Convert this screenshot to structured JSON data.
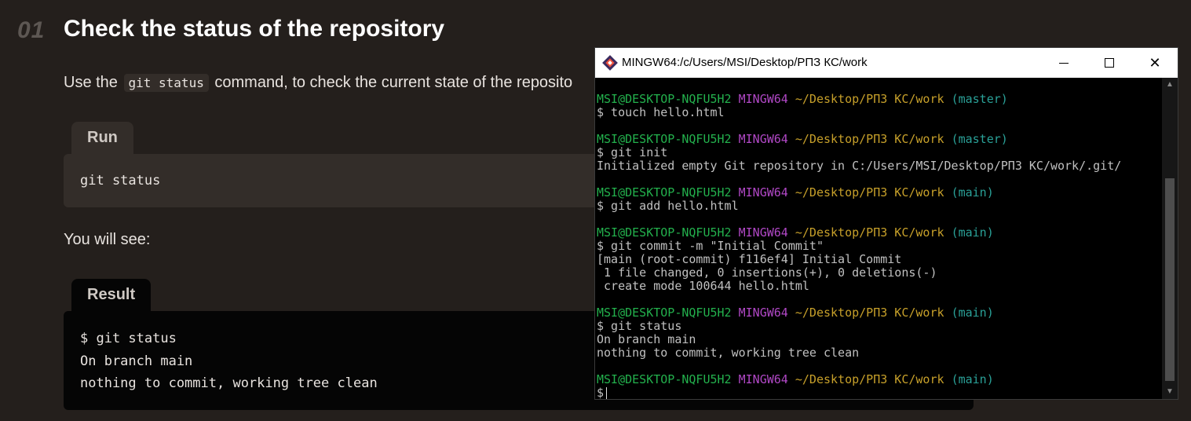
{
  "tutorial": {
    "step_number": "01",
    "title": "Check the status of the repository",
    "intro_before": "Use the",
    "intro_code": "git status",
    "intro_after": "command, to check the current state of the reposito",
    "run_tab": "Run",
    "run_code": "git status",
    "see_text": "You will see:",
    "result_tab": "Result",
    "result_lines": [
      "$ git status",
      "On branch main",
      "nothing to commit, working tree clean"
    ]
  },
  "terminal": {
    "window_title": "MINGW64:/c/Users/MSI/Desktop/РПЗ КС/work",
    "user_host": "MSI@DESKTOP-NQFU5H2",
    "shell": "MINGW64",
    "path": "~/Desktop/РПЗ КС/work",
    "branch_master": "(master)",
    "branch_main": "(main)",
    "cmd_touch": "$ touch hello.html",
    "cmd_init": "$ git init",
    "out_init": "Initialized empty Git repository in C:/Users/MSI/Desktop/РПЗ КС/work/.git/",
    "cmd_add": "$ git add hello.html",
    "cmd_commit": "$ git commit -m \"Initial Commit\"",
    "out_commit_1": "[main (root-commit) f116ef4] Initial Commit",
    "out_commit_2": " 1 file changed, 0 insertions(+), 0 deletions(-)",
    "out_commit_3": " create mode 100644 hello.html",
    "cmd_status": "$ git status",
    "out_status_1": "On branch main",
    "out_status_2": "nothing to commit, working tree clean",
    "prompt_symbol": "$"
  },
  "icons": {
    "app": "git-bash-icon",
    "minimize": "minimize-icon",
    "maximize": "maximize-icon",
    "close": "close-icon"
  },
  "colors": {
    "background": "#241f1c",
    "prompt_user": "#23b14d",
    "prompt_shell": "#b148c6",
    "prompt_path": "#c7a02a",
    "prompt_branch": "#2aa198"
  }
}
